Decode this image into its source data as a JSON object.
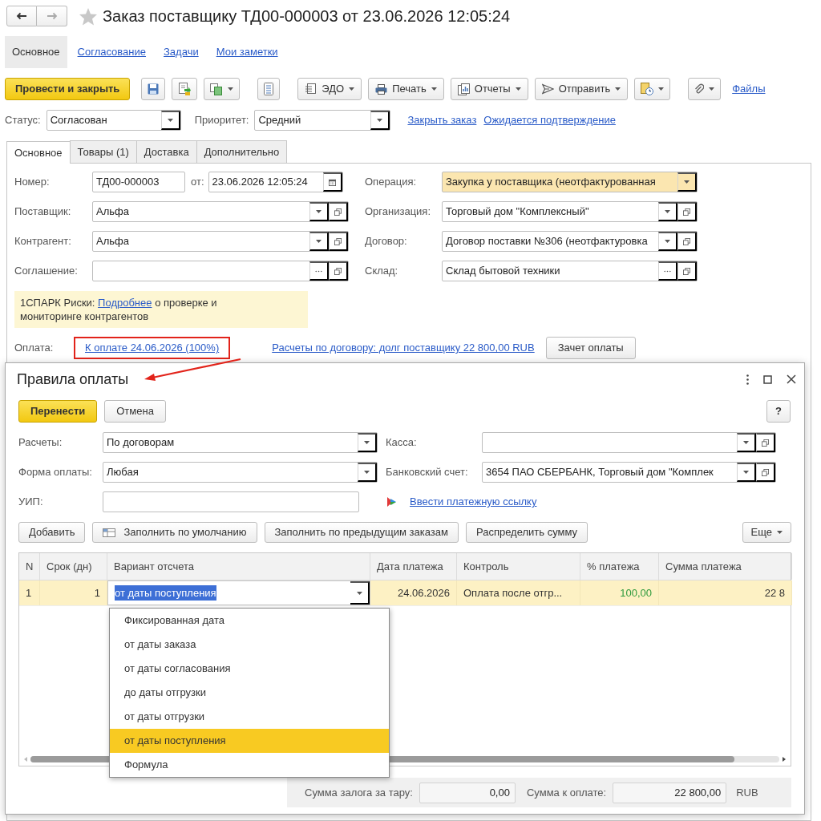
{
  "window": {
    "title": "Заказ поставщику ТД00-000003 от 23.06.2026 12:05:24"
  },
  "sections": [
    {
      "label": "Основное",
      "selected": true
    },
    {
      "label": "Согласование",
      "selected": false
    },
    {
      "label": "Задачи",
      "selected": false
    },
    {
      "label": "Мои заметки",
      "selected": false
    }
  ],
  "toolbar": [
    {
      "kind": "primary",
      "label": "Провести и закрыть"
    },
    {
      "kind": "icon",
      "dropdown": false
    },
    {
      "kind": "icon",
      "dropdown": false
    },
    {
      "kind": "icon",
      "dropdown": true
    },
    {
      "kind": "icon",
      "dropdown": false
    },
    {
      "kind": "button",
      "label": "ЭДО",
      "dropdown": true
    },
    {
      "kind": "button",
      "label": "Печать",
      "dropdown": true
    },
    {
      "kind": "button",
      "label": "Отчеты",
      "dropdown": true
    },
    {
      "kind": "button",
      "label": "Отправить",
      "dropdown": true
    },
    {
      "kind": "icon",
      "dropdown": true
    },
    {
      "kind": "icon",
      "dropdown": true
    },
    {
      "kind": "link",
      "label": "Файлы"
    }
  ],
  "status_bar": {
    "fields": [
      {
        "label": "Статус:",
        "value": "Согласован"
      },
      {
        "label": "Приоритет:",
        "value": "Средний"
      }
    ],
    "links": [
      "Закрыть заказ",
      "Ожидается подтверждение"
    ]
  },
  "tabs": [
    {
      "label": "Основное",
      "selected": true
    },
    {
      "label": "Товары (1)",
      "selected": false
    },
    {
      "label": "Доставка",
      "selected": false
    },
    {
      "label": "Дополнительно",
      "selected": false
    }
  ],
  "form": {
    "left": [
      {
        "label": "Номер:",
        "value": "ТД00-000003",
        "kind": "plain",
        "highlighted": false,
        "date_label": "от:",
        "date": "23.06.2026 12:05:24"
      },
      {
        "label": "Поставщик:",
        "value": "Альфа",
        "kind": "ref",
        "highlighted": false
      },
      {
        "label": "Контрагент:",
        "value": "Альфа",
        "kind": "ref",
        "highlighted": false
      },
      {
        "label": "Соглашение:",
        "kind": "pick",
        "highlighted": false
      }
    ],
    "right": [
      {
        "label": "Операция:",
        "value": "Закупка у поставщика (неотфактурованная",
        "kind": "dropdown",
        "highlighted": true
      },
      {
        "label": "Организация:",
        "value": "Торговый дом \"Комплексный\"",
        "kind": "ref",
        "highlighted": false
      },
      {
        "label": "Договор:",
        "value": "Договор поставки №306 (неотфактуровка",
        "kind": "ref",
        "highlighted": false
      },
      {
        "label": "Склад:",
        "value": "Склад бытовой техники",
        "kind": "pick",
        "highlighted": false
      }
    ]
  },
  "notice": {
    "prefix": "1СПАРК Риски:",
    "link": "Подробнее",
    "suffix": "о проверке и мониторинге контрагентов"
  },
  "payment": {
    "label": "Оплата:",
    "link": "К оплате 24.06.2026 (100%)",
    "highlighted": true,
    "debt_link": "Расчеты по договору: долг поставщику 22 800,00 RUB",
    "button": "Зачет оплаты"
  },
  "dialog": {
    "title": "Правила оплаты",
    "buttons": [
      {
        "kind": "primary",
        "label": "Перенести"
      },
      {
        "kind": "button",
        "label": "Отмена"
      }
    ],
    "help": "?",
    "left": [
      {
        "label": "Расчеты:",
        "value": "По договорам",
        "kind": "dropdown"
      },
      {
        "label": "Форма оплаты:",
        "value": "Любая",
        "kind": "dropdown"
      },
      {
        "label": "УИП:",
        "kind": "plain"
      }
    ],
    "right": [
      {
        "label": "Касса:",
        "kind": "ref"
      },
      {
        "label": "Банковский счет:",
        "value": "3654 ПАО СБЕРБАНК, Торговый дом \"Комплек",
        "kind": "ref"
      }
    ],
    "payment_link": "Ввести платежную ссылку",
    "actions": [
      {
        "label": "Добавить",
        "icon": false
      },
      {
        "label": "Заполнить по умолчанию",
        "icon": true
      },
      {
        "label": "Заполнить по предыдущим заказам",
        "icon": false
      },
      {
        "label": "Распределить сумму",
        "icon": false
      }
    ],
    "more": "Еще",
    "table": {
      "columns": [
        "N",
        "Срок (дн)",
        "Вариант отсчета",
        "Дата платежа",
        "Контроль",
        "% платежа",
        "Сумма платежа"
      ],
      "rows": [
        {
          "selected": true,
          "cells": [
            {
              "text": "1",
              "editing": false
            },
            {
              "text": "1",
              "editing": false
            },
            {
              "text": "от даты поступления",
              "editing": true
            },
            {
              "text": "24.06.2026",
              "editing": false
            },
            {
              "text": "Оплата после отгр...",
              "editing": false
            },
            {
              "text": "100,00",
              "editing": false,
              "color": "#2e9a3c"
            },
            {
              "text": "22 8",
              "editing": false
            }
          ]
        }
      ]
    },
    "dropdown": [
      {
        "label": "Фиксированная дата",
        "selected": false
      },
      {
        "label": "от даты заказа",
        "selected": false
      },
      {
        "label": "от даты согласования",
        "selected": false
      },
      {
        "label": "до даты отгрузки",
        "selected": false
      },
      {
        "label": "от даты отгрузки",
        "selected": false
      },
      {
        "label": "от даты поступления",
        "selected": true
      },
      {
        "label": "Формула",
        "selected": false
      }
    ],
    "footer": [
      {
        "label": "Сумма залога за тару:",
        "value": "0,00"
      },
      {
        "label": "Сумма к оплате:",
        "value": "22 800,00",
        "unit": "RUB"
      }
    ]
  }
}
